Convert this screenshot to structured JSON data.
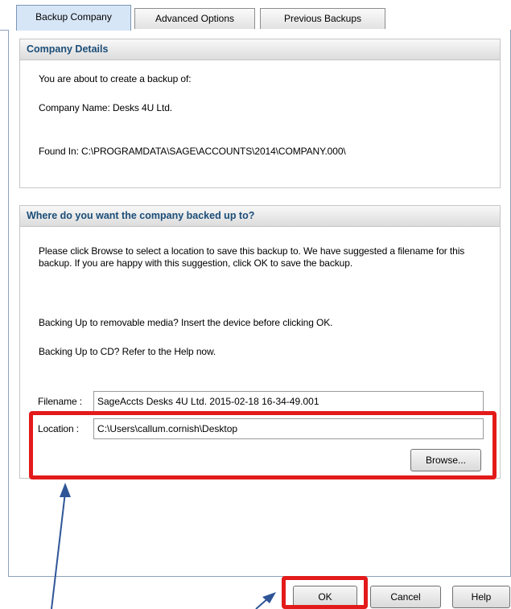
{
  "tabs": [
    {
      "label": "Backup Company"
    },
    {
      "label": "Advanced Options"
    },
    {
      "label": "Previous Backups"
    }
  ],
  "company_details": {
    "heading": "Company Details",
    "intro": "You are about to create a backup of:",
    "company_name_line": "Company Name:  Desks 4U Ltd.",
    "found_in_line": "Found In:  C:\\PROGRAMDATA\\SAGE\\ACCOUNTS\\2014\\COMPANY.000\\"
  },
  "destination": {
    "heading": "Where do you want the company backed up to?",
    "instructions": "Please click Browse to select a location to save this backup to. We have suggested a filename for this backup. If you are happy with this suggestion, click OK to save the backup.",
    "removable_note": "Backing Up to removable media?  Insert the device before clicking OK.",
    "cd_note": "Backing Up to CD?  Refer to the Help now.",
    "filename_label": "Filename :",
    "filename_value": "SageAccts Desks 4U Ltd. 2015-02-18 16-34-49.001",
    "location_label": "Location :",
    "location_value": "C:\\Users\\callum.cornish\\Desktop",
    "browse_label": "Browse..."
  },
  "footer": {
    "ok_label": "OK",
    "cancel_label": "Cancel",
    "help_label": "Help"
  },
  "colors": {
    "annotation_red": "#e31a1a",
    "arrow_blue": "#2f5597",
    "heading_blue": "#1b4d78"
  }
}
